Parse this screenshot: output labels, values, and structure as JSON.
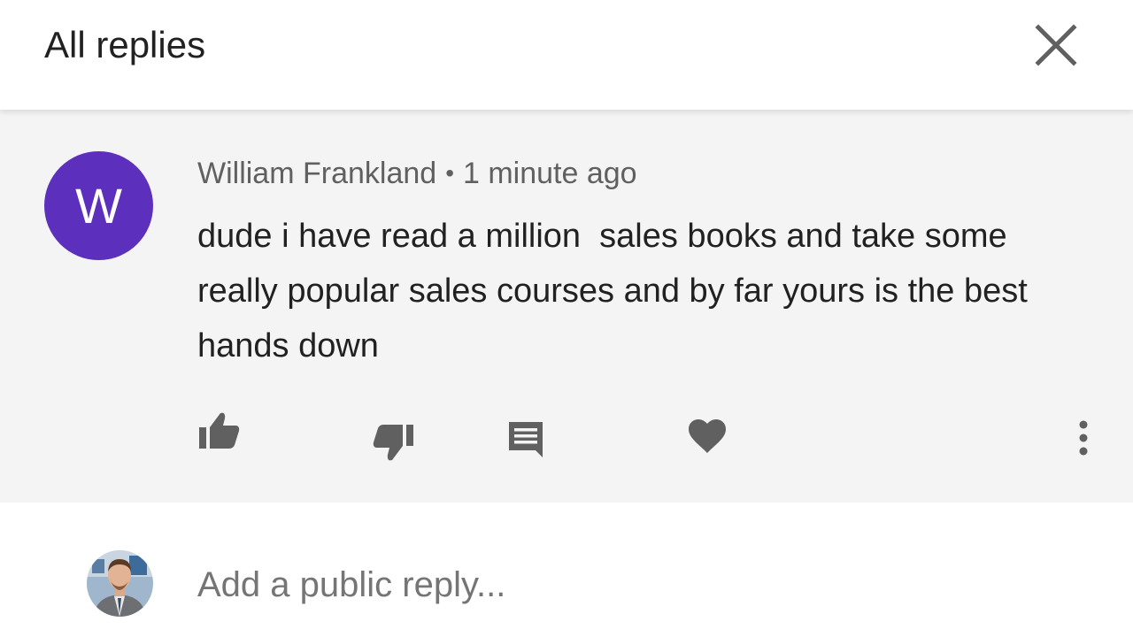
{
  "header": {
    "title": "All replies",
    "close_icon": "close-icon"
  },
  "comment": {
    "avatar_letter": "W",
    "avatar_color": "#5c2fbd",
    "author": "William Frankland",
    "separator": "•",
    "time": "1 minute ago",
    "text": "dude i have read a million  sales books and take some really popular sales courses and by far yours is the best hands down",
    "actions": [
      {
        "name": "like",
        "icon": "thumb-up-icon"
      },
      {
        "name": "dislike",
        "icon": "thumb-down-icon"
      },
      {
        "name": "reply",
        "icon": "comment-icon"
      },
      {
        "name": "heart",
        "icon": "heart-icon"
      },
      {
        "name": "more",
        "icon": "more-vert-icon"
      }
    ]
  },
  "reply_box": {
    "placeholder": "Add a public reply...",
    "value": "",
    "avatar_icon": "user-photo-avatar"
  },
  "colors": {
    "comment_background": "#f4f4f4",
    "icon_gray": "#606060",
    "text_primary": "#212121",
    "text_secondary": "#606060"
  }
}
